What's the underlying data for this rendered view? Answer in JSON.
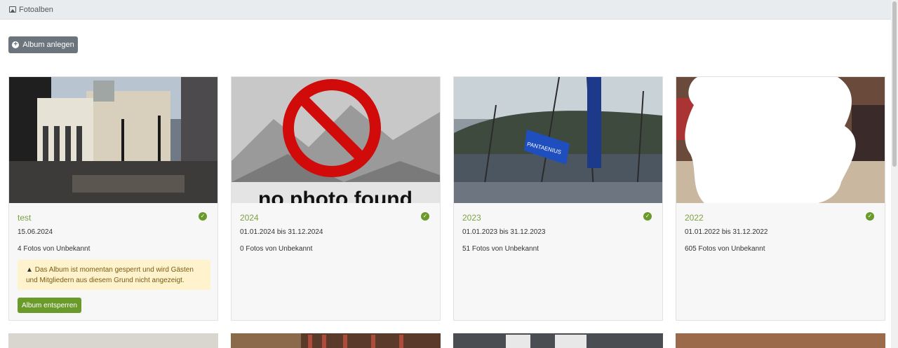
{
  "header": {
    "title": "Fotoalben",
    "icon": "image-icon"
  },
  "toolbar": {
    "add_album_label": "Album anlegen"
  },
  "albums": [
    {
      "title": "test",
      "date": "15.06.2024",
      "count": "4 Fotos von Unbekannt",
      "warning": "Das Album ist momentan gesperrt und wird Gästen und Mitgliedern aus diesem Grund nicht angezeigt.",
      "unlock_label": "Album entsperren"
    },
    {
      "title": "2024",
      "date": "01.01.2024 bis 31.12.2024",
      "count": "0 Fotos von Unbekannt",
      "placeholder_text": "no photo found"
    },
    {
      "title": "2023",
      "date": "01.01.2023 bis 31.12.2023",
      "count": "51 Fotos von Unbekannt",
      "flag_text": "PANTAENIUS"
    },
    {
      "title": "2022",
      "date": "01.01.2022 bis 31.12.2022",
      "count": "605 Fotos von Unbekannt"
    }
  ],
  "colors": {
    "accent": "#6a9a2a",
    "title_green": "#7ba23f",
    "warning_bg": "#fff3cd",
    "button_gray": "#6c757d"
  }
}
